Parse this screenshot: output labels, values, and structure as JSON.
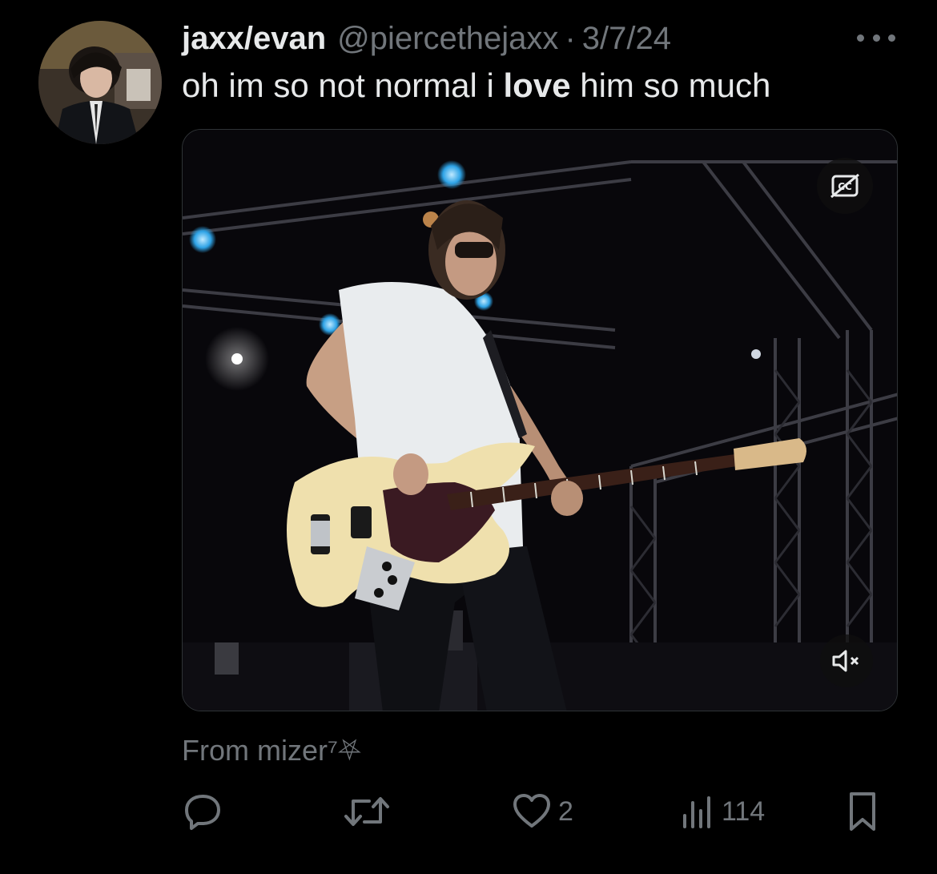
{
  "author": {
    "display_name": "jaxx/evan",
    "handle": "@piercethejaxx",
    "separator": "·",
    "date": "3/7/24"
  },
  "tweet": {
    "text_before": "oh im so not normal i ",
    "text_bold": "love",
    "text_after": " him so much"
  },
  "media": {
    "type": "video",
    "captions_icon": "cc-off-icon",
    "sound_icon": "muted-speaker-icon"
  },
  "source": {
    "text": "From mizer⁷⛧"
  },
  "actions": {
    "reply": {
      "icon": "reply-icon",
      "count": ""
    },
    "retweet": {
      "icon": "retweet-icon",
      "count": ""
    },
    "like": {
      "icon": "heart-icon",
      "count": "2"
    },
    "views": {
      "icon": "views-icon",
      "count": "114"
    },
    "bookmark": {
      "icon": "bookmark-icon",
      "count": ""
    }
  },
  "colors": {
    "background": "#000000",
    "primary_text": "#e7e9ea",
    "secondary_text": "#71767b",
    "border": "#2f3336"
  }
}
